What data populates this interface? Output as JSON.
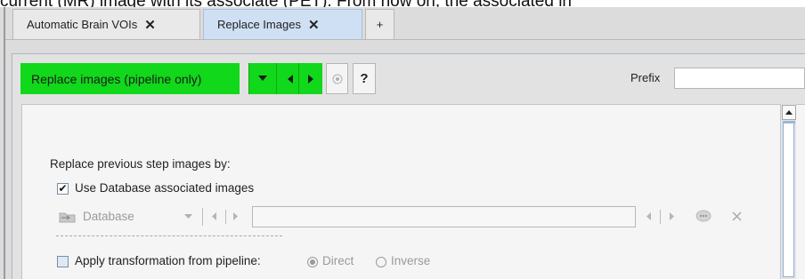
{
  "doc_text": "current (MR) image with its associate (PET). From now on, the associated in",
  "tabs": [
    {
      "label": "Automatic Brain VOIs",
      "close": "✕"
    },
    {
      "label": "Replace Images",
      "close": "✕"
    },
    {
      "label": "+"
    }
  ],
  "step": {
    "label": "Replace images (pipeline only)",
    "help": "?"
  },
  "prefix": {
    "label": "Prefix",
    "value": ""
  },
  "form": {
    "heading": "Replace previous step images by:",
    "use_db": {
      "label": "Use Database associated images",
      "checked": true
    },
    "database": {
      "label": "Database",
      "path_value": ""
    },
    "apply_transform": {
      "label": "Apply transformation from pipeline:",
      "checked": false
    },
    "direction": {
      "direct": "Direct",
      "inverse": "Inverse",
      "selected": "Direct"
    }
  },
  "colors": {
    "accent_green": "#11d81a",
    "active_tab": "#cfe0f4"
  }
}
